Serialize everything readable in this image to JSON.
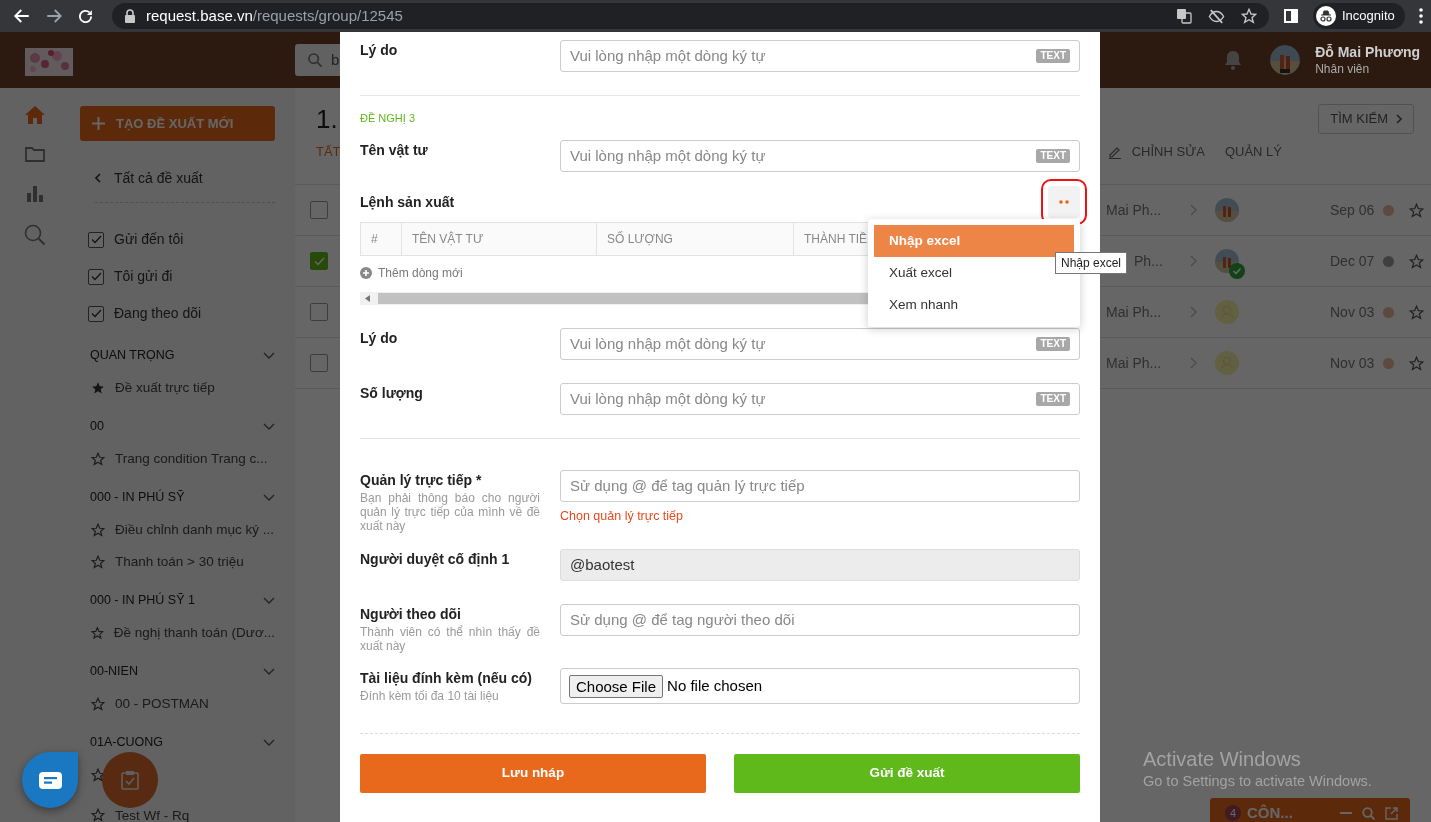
{
  "browser": {
    "url_host": "request.base.vn",
    "url_path": "/requests/group/12545",
    "profile": "Incognito"
  },
  "header": {
    "search_value": "b",
    "user_name": "Đỗ Mai Phương",
    "user_role": "Nhân viên"
  },
  "sidebar": {
    "create_button": "TẠO ĐỀ XUẤT MỚI",
    "back_link": "Tất cả đề xuất",
    "filters": [
      {
        "label": "Gửi đến tôi",
        "checked": true
      },
      {
        "label": "Tôi gửi đi",
        "checked": true
      },
      {
        "label": "Đang theo dõi",
        "checked": true
      }
    ],
    "groups": [
      {
        "title": "QUAN TRỌNG",
        "expanded": true,
        "items": [
          {
            "label": "Đề xuất trực tiếp",
            "starred": true
          }
        ]
      },
      {
        "title": "00",
        "expanded": true,
        "items": [
          {
            "label": "Trang condition Trang c...",
            "starred": false
          }
        ]
      },
      {
        "title": "000 - IN PHÚ SỸ",
        "expanded": true,
        "items": [
          {
            "label": "Điều chỉnh danh mục ký ...",
            "starred": false
          },
          {
            "label": "Thanh toán > 30 triệu",
            "starred": false
          }
        ]
      },
      {
        "title": "000 - IN PHÚ SỸ 1",
        "expanded": true,
        "items": [
          {
            "label": "Đề nghị thanh toán (Dươ...",
            "starred": false
          }
        ]
      },
      {
        "title": "00-NIEN",
        "expanded": true,
        "items": [
          {
            "label": "00 - POSTMAN",
            "starred": false
          }
        ]
      },
      {
        "title": "01A-CUONG",
        "expanded": true,
        "items": [
          {
            "starred": false
          },
          {
            "label": "Test Wf - Rq",
            "starred": false
          }
        ]
      }
    ]
  },
  "main": {
    "title": "1.",
    "search_button": "TÌM KIẾM",
    "tabs": [
      {
        "label": "TẤT",
        "selected": true
      }
    ],
    "actions": [
      {
        "label": "CHỈNH SỬA",
        "kind": "edit"
      },
      {
        "label": "QUẢN LÝ",
        "kind": "plain"
      }
    ],
    "rows": [
      {
        "checked": false,
        "name": "Mai Ph...",
        "approved": false,
        "date": "Sep 06",
        "color": "#5c4940"
      },
      {
        "checked": true,
        "name": "Ph...",
        "approved": true,
        "date": "Dec 07",
        "color": "#3f3f3f"
      },
      {
        "checked": false,
        "name": "Mai Ph...",
        "kind": "placeholder",
        "approved": false,
        "date": "Nov 03",
        "color": "#5c4940"
      },
      {
        "checked": false,
        "name": "Mai Ph...",
        "kind": "placeholder",
        "approved": false,
        "date": "Nov 03",
        "color": "#5c4940"
      }
    ]
  },
  "modal": {
    "sections": [
      {
        "kind": "field",
        "label": "Lý do",
        "placeholder": "Vui lòng nhập một dòng ký tự",
        "badge": "TEXT"
      },
      {
        "kind": "divider"
      },
      {
        "kind": "heading",
        "text": "ĐỀ NGHỊ 3"
      },
      {
        "kind": "field",
        "label": "Tên vật tư",
        "placeholder": "Vui lòng nhập một dòng ký tự",
        "badge": "TEXT"
      },
      {
        "kind": "table",
        "label": "Lệnh sản xuất",
        "columns": [
          "#",
          "TÊN VẬT TƯ",
          "SỐ LƯỢNG",
          "THÀNH TIỀ"
        ],
        "add_row": "Thêm dòng mới",
        "highlighted": true,
        "menu_open": true,
        "menu": [
          {
            "label": "Nhập excel",
            "selected": true
          },
          {
            "label": "Xuất excel",
            "selected": false
          },
          {
            "label": "Xem nhanh",
            "selected": false
          }
        ],
        "tooltip": "Nhập excel"
      },
      {
        "kind": "field",
        "label": "Lý do",
        "placeholder": "Vui lòng nhập một dòng ký tự",
        "badge": "TEXT"
      },
      {
        "kind": "field",
        "label": "Số lượng",
        "placeholder": "Vui lòng nhập một dòng ký tự",
        "badge": "TEXT"
      },
      {
        "kind": "divider"
      },
      {
        "kind": "person",
        "label": "Quản lý trực tiếp *",
        "hint": "Bạn phải thông báo cho người quản lý trực tiếp của mình về đề xuất này",
        "placeholder": "Sử dụng @ để tag quản lý trực tiếp",
        "error": "Chọn quản lý trực tiếp"
      },
      {
        "kind": "readonly",
        "label": "Người duyệt cố định 1",
        "value": "@baotest"
      },
      {
        "kind": "person",
        "label": "Người theo dõi",
        "hint": "Thành viên có thể nhìn thấy đề xuất này",
        "placeholder": "Sử dụng @ để tag người theo dõi"
      },
      {
        "kind": "file",
        "label": "Tài liệu đính kèm (nếu có)",
        "hint": "Đính kèm tối đa 10 tài liệu",
        "button": "Choose File",
        "status": "No file chosen"
      }
    ],
    "buttons": [
      {
        "label": "Lưu nháp",
        "kind": "draft"
      },
      {
        "label": "Gửi đề xuất",
        "kind": "submit"
      }
    ]
  },
  "chat_widget": {
    "count": "4",
    "title": "CÔN..."
  },
  "os_notice": {
    "title": "Activate Windows",
    "text": "Go to Settings to activate Windows."
  }
}
